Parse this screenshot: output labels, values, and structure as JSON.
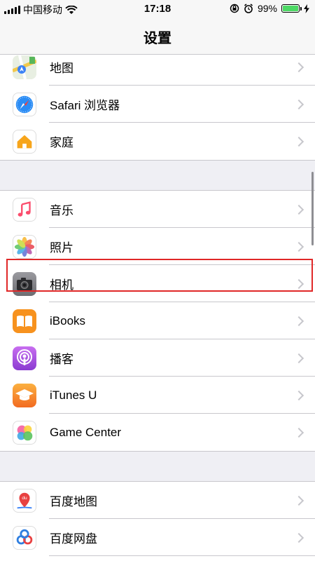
{
  "status_bar": {
    "carrier": "中国移动",
    "time": "17:18",
    "battery_percent": "99%",
    "battery_level": 0.99,
    "icons": [
      "signal-icon",
      "wifi-icon",
      "rotation-lock-icon",
      "alarm-icon",
      "battery-icon",
      "charging-icon"
    ]
  },
  "nav": {
    "title": "设置"
  },
  "groups": [
    {
      "items": [
        {
          "label": "地图",
          "icon": "maps-icon"
        },
        {
          "label": "Safari 浏览器",
          "icon": "safari-icon"
        },
        {
          "label": "家庭",
          "icon": "home-icon"
        }
      ]
    },
    {
      "items": [
        {
          "label": "音乐",
          "icon": "music-icon"
        },
        {
          "label": "照片",
          "icon": "photos-icon"
        },
        {
          "label": "相机",
          "icon": "camera-icon"
        },
        {
          "label": "iBooks",
          "icon": "ibooks-icon"
        },
        {
          "label": "播客",
          "icon": "podcasts-icon"
        },
        {
          "label": "iTunes U",
          "icon": "itunes-u-icon"
        },
        {
          "label": "Game Center",
          "icon": "game-center-icon"
        }
      ]
    },
    {
      "items": [
        {
          "label": "百度地图",
          "icon": "baidu-maps-icon"
        },
        {
          "label": "百度网盘",
          "icon": "baidu-netdisk-icon"
        }
      ]
    }
  ],
  "colors": {
    "highlight": "#e02828",
    "background": "#efeff4",
    "battery": "#4cd964"
  }
}
